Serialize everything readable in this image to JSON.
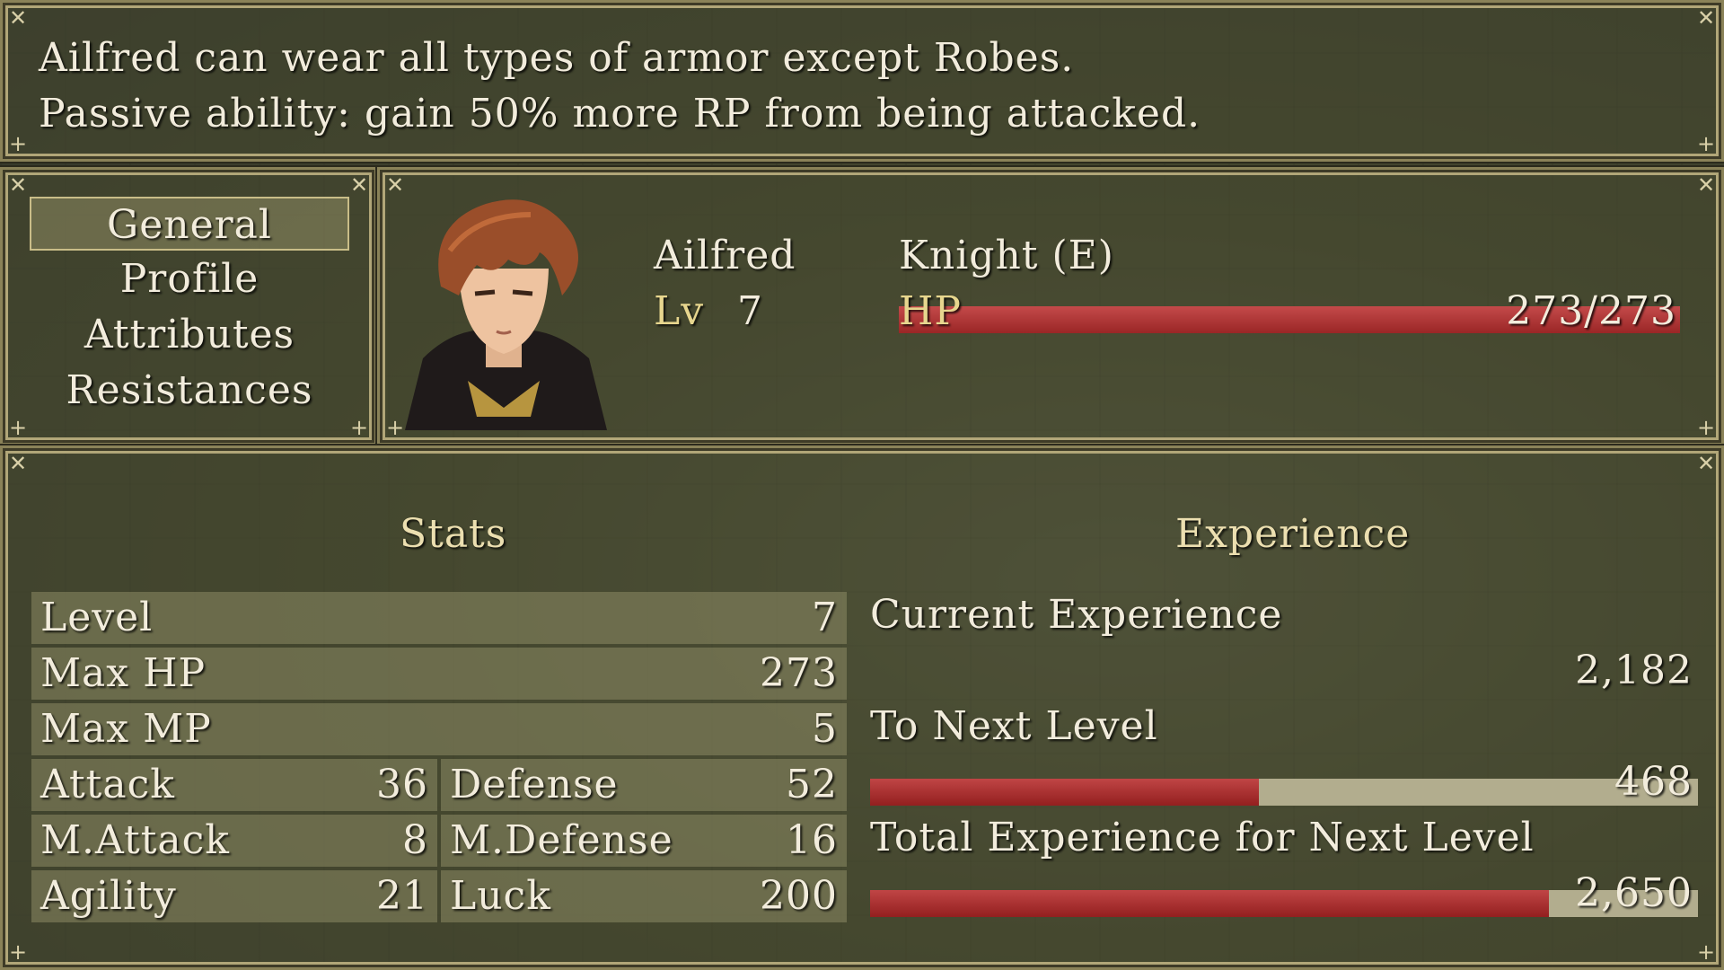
{
  "help": {
    "line1": "Ailfred can wear all types of armor except Robes.",
    "line2": "Passive ability: gain 50% more RP from being attacked."
  },
  "menu": {
    "items": [
      "General",
      "Profile",
      "Attributes",
      "Resistances"
    ],
    "selected": "General"
  },
  "actor": {
    "name": "Ailfred",
    "class": "Knight (E)",
    "level_label": "Lv",
    "level": "7",
    "hp_label": "HP",
    "hp": "273/273",
    "hp_fraction": 1.0
  },
  "stats": {
    "heading": "Stats",
    "level": {
      "label": "Level",
      "value": "7"
    },
    "max_hp": {
      "label": "Max HP",
      "value": "273"
    },
    "max_mp": {
      "label": "Max MP",
      "value": "5"
    },
    "attack": {
      "label": "Attack",
      "value": "36"
    },
    "defense": {
      "label": "Defense",
      "value": "52"
    },
    "m_attack": {
      "label": "M.Attack",
      "value": "8"
    },
    "m_defense": {
      "label": "M.Defense",
      "value": "16"
    },
    "agility": {
      "label": "Agility",
      "value": "21"
    },
    "luck": {
      "label": "Luck",
      "value": "200"
    }
  },
  "experience": {
    "heading": "Experience",
    "current_label": "Current Experience",
    "current_value": "2,182",
    "next_label": "To Next Level",
    "next_value": "468",
    "next_fraction": 0.47,
    "total_label": "Total Experience for Next Level",
    "total_value": "2,650",
    "total_fraction": 0.82
  },
  "colors": {
    "bar_fill": "#b02c2c",
    "bar_track": "#b2ad8e",
    "system_label": "#e7d68e"
  },
  "portrait": {
    "icon": "portrait-ailfred"
  }
}
